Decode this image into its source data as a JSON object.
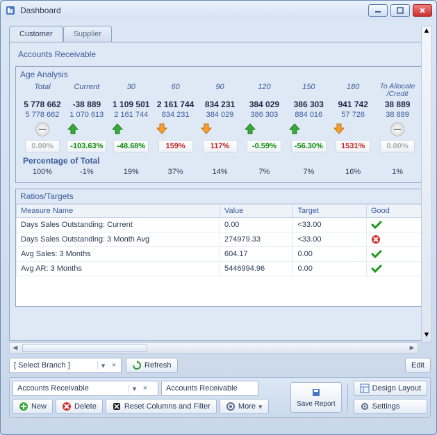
{
  "window": {
    "title": "Dashboard"
  },
  "tabs": {
    "customer": "Customer",
    "supplier": "Supplier"
  },
  "panel_title": "Accounts Receivable",
  "age": {
    "title": "Age Analysis",
    "headers": [
      "Total",
      "Current",
      "30",
      "60",
      "90",
      "120",
      "150",
      "180",
      "To Allocate /Credit"
    ],
    "bold": [
      "5 778 662",
      "-38 889",
      "1 109 501",
      "2 161 744",
      "834 231",
      "384 029",
      "386 303",
      "941 742",
      "38 889"
    ],
    "sub": [
      "5 778 662",
      "1 070 613",
      "2 161 744",
      "834 231",
      "384 029",
      "386 303",
      "884 016",
      "57 726",
      "38 889"
    ],
    "dir": [
      "minus",
      "up-g",
      "up-g",
      "dn-o",
      "dn-o",
      "up-g",
      "up-g",
      "dn-o",
      "minus"
    ],
    "pct": [
      "0.00%",
      "-103.63%",
      "-48.68%",
      "159%",
      "117%",
      "-0.59%",
      "-56.30%",
      "1531%",
      "0.00%"
    ],
    "pctc": [
      "gray",
      "green",
      "green",
      "red",
      "red",
      "green",
      "green",
      "red",
      "gray"
    ],
    "pot_label": "Percentage of Total",
    "pot": [
      "100%",
      "-1%",
      "19%",
      "37%",
      "14%",
      "7%",
      "7%",
      "16%",
      "1%"
    ]
  },
  "ratio": {
    "title": "Ratios/Targets",
    "cols": [
      "Measure Name",
      "Value",
      "Target",
      "Good"
    ],
    "rows": [
      {
        "m": "Days Sales Outstanding: Current",
        "v": "0.00",
        "t": "<33.00",
        "g": "ok"
      },
      {
        "m": "Days Sales Outstanding: 3 Month Avg",
        "v": "274979.33",
        "t": "<33.00",
        "g": "bad"
      },
      {
        "m": "Avg Sales: 3 Months",
        "v": "604.17",
        "t": "0.00",
        "g": "ok"
      },
      {
        "m": "Avg AR: 3 Months",
        "v": "5446994.96",
        "t": "0.00",
        "g": "ok"
      }
    ]
  },
  "toolbar": {
    "branch_placeholder": "[ Select Branch ]",
    "refresh": "Refresh",
    "edit": "Edit",
    "ar1": "Accounts Receivable",
    "ar2": "Accounts Receivable",
    "new": "New",
    "delete": "Delete",
    "reset": "Reset Columns and Filter",
    "more": "More",
    "save_report": "Save Report",
    "design_layout": "Design Layout",
    "settings": "Settings"
  }
}
